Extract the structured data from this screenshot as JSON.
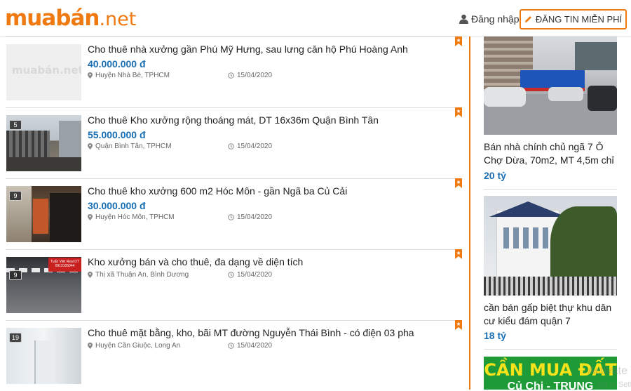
{
  "header": {
    "logo_brand": "muabán",
    "logo_tld": ".net",
    "login_label": "Đăng nhập",
    "post_button_label": "ĐĂNG TIN MIỄN PHÍ",
    "accent": "#ef7a12"
  },
  "listings": [
    {
      "title": "Cho thuê nhà xưởng gần Phú Mỹ Hưng, sau lưng căn hộ Phú Hoàng Anh",
      "price": "40.000.000 đ",
      "location": "Huyện Nhà Bè, TPHCM",
      "date": "15/04/2020",
      "photo_count": "",
      "placeholder_logo": "muabán.net"
    },
    {
      "title": "Cho thuê Kho xưởng rộng thoáng mát, DT 16x36m Quận Bình Tân",
      "price": "55.000.000 đ",
      "location": "Quận Bình Tân, TPHCM",
      "date": "15/04/2020",
      "photo_count": "5"
    },
    {
      "title": "Cho thuê kho xưởng 600 m2 Hóc Môn - gần Ngã ba Củ Cải",
      "price": "30.000.000 đ",
      "location": "Huyện Hóc Môn, TPHCM",
      "date": "15/04/2020",
      "photo_count": "9"
    },
    {
      "title": "Kho xưởng bán và cho thuê, đa dạng về diện tích",
      "price": "",
      "location": "Thị xã Thuận An, Bình Dương",
      "date": "15/04/2020",
      "photo_count": "9",
      "photo_banner": "Tuấn Việt Real DT 0913105044"
    },
    {
      "title": "Cho thuê mặt bằng, kho, bãi MT đường Nguyễn Thái Bình - có điện 03 pha",
      "price": "",
      "location": "Huyện Cần Giuộc, Long An",
      "date": "15/04/2020",
      "photo_count": "19"
    }
  ],
  "sidebar": [
    {
      "title": "Bán nhà chính chủ ngã 7 Ô Chợ Dừa, 70m2, MT 4,5m chỉ",
      "price": "20 tỷ"
    },
    {
      "title": "cần bán gấp biệt thự khu dân cư kiểu đám quận 7",
      "price": "18 tỷ"
    },
    {
      "banner_text": "CẦN MUA ĐẤT",
      "banner_text_2": "Củ Chi - TRUNG"
    }
  ],
  "overlay": {
    "line1": "Activate Win",
    "line2": "Go to Settings"
  },
  "icons": {
    "login": "user-icon",
    "post": "pencil-icon",
    "location": "map-pin-icon",
    "date": "clock-icon",
    "save": "bookmark-icon"
  }
}
